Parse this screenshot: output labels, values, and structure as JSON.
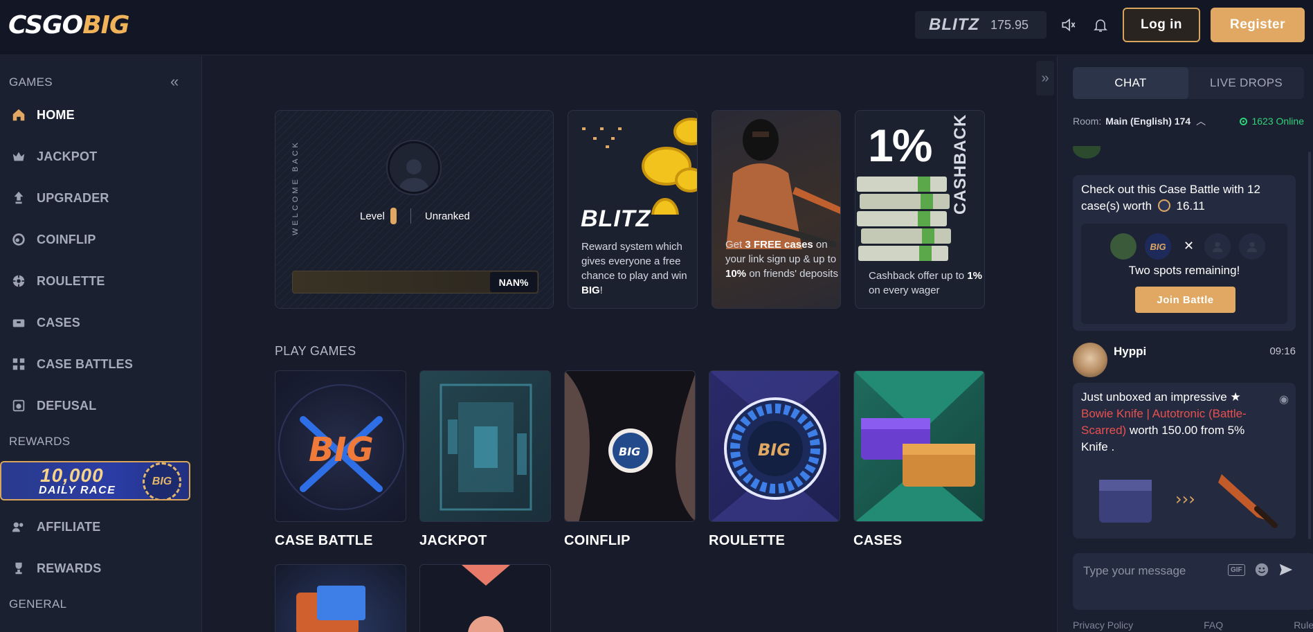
{
  "header": {
    "logo_prefix": "CSGO",
    "logo_suffix": "BIG",
    "blitz_label": "BLITZ",
    "blitz_value": "175.95",
    "login_label": "Log in",
    "register_label": "Register",
    "accent": "#e0a862"
  },
  "sidebar": {
    "games_title": "GAMES",
    "items": [
      {
        "label": "HOME",
        "icon": "home-icon"
      },
      {
        "label": "JACKPOT",
        "icon": "crown-icon"
      },
      {
        "label": "UPGRADER",
        "icon": "upgrade-arrow-icon"
      },
      {
        "label": "COINFLIP",
        "icon": "coin-icon"
      },
      {
        "label": "ROULETTE",
        "icon": "roulette-icon"
      },
      {
        "label": "CASES",
        "icon": "case-icon"
      },
      {
        "label": "CASE BATTLES",
        "icon": "battle-icon"
      },
      {
        "label": "DEFUSAL",
        "icon": "bomb-icon"
      }
    ],
    "rewards_title": "REWARDS",
    "race_amount": "10,000",
    "race_text": "DAILY RACE",
    "race_chip": "BIG",
    "reward_items": [
      {
        "label": "AFFILIATE",
        "icon": "affiliate-icon"
      },
      {
        "label": "REWARDS",
        "icon": "trophy-icon"
      }
    ],
    "general_title": "GENERAL"
  },
  "welcome": {
    "vertical_text": "WELCOME BACK",
    "level_label": "Level",
    "rank": "Unranked",
    "progress_text": "NAN%"
  },
  "promos": {
    "blitz_title": "BLITZ",
    "blitz_text_1": "Reward system which gives everyone a free chance to play and win ",
    "blitz_text_bold": "BIG",
    "blitz_text_2": "!",
    "free_1": "Get ",
    "free_bold_1": "3 FREE cases",
    "free_2": " on your link sign up & up to ",
    "free_bold_2": "10%",
    "free_3": " on friends' deposits",
    "cash_big": "1%",
    "cash_vert": "CASHBACK",
    "cash_text_1": "Cashback offer up to ",
    "cash_bold": "1%",
    "cash_text_2": " on every wager"
  },
  "games": {
    "title": "PLAY GAMES",
    "tiles": [
      "CASE BATTLE",
      "JACKPOT",
      "COINFLIP",
      "ROULETTE",
      "CASES"
    ]
  },
  "chat": {
    "tab_chat": "CHAT",
    "tab_drops": "LIVE DROPS",
    "room_label": "Room:",
    "room_name": "Main (English) 174",
    "online": "1623 Online",
    "battle_msg_1": "Check out this Case Battle with 12 case(s) worth",
    "battle_value": "16.11",
    "spots": "Two spots remaining!",
    "join_label": "Join Battle",
    "user_name": "Hyppi",
    "user_time": "09:16",
    "unbox_1": "Just unboxed an impressive ★",
    "unbox_item": "Bowie Knife | Autotronic (Battle-Scarred)",
    "unbox_2": " worth 150.00 from 5% Knife .",
    "input_placeholder": "Type your message",
    "gif_label": "GIF",
    "footer": [
      "Privacy Policy",
      "FAQ",
      "Rules"
    ]
  }
}
